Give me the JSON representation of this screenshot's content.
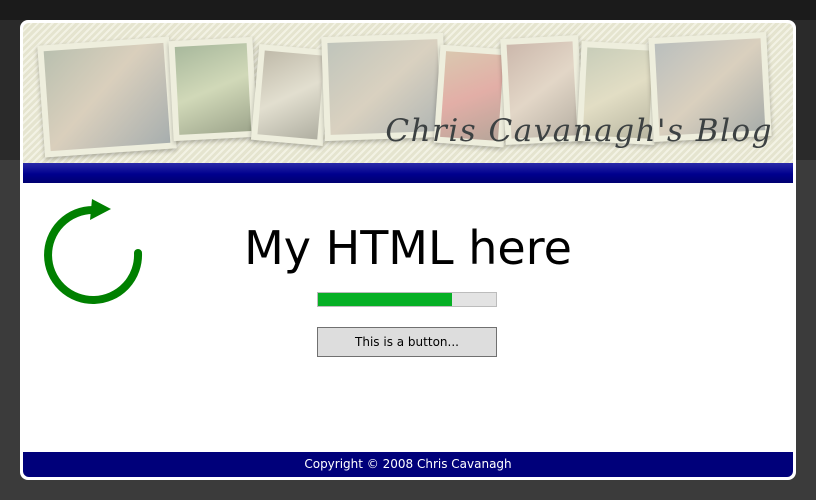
{
  "header": {
    "blog_title": "Chris Cavanagh's Blog",
    "photo_count": 8
  },
  "main": {
    "heading": "My HTML here",
    "progress_fraction": 0.75,
    "button_label": "This is a button..."
  },
  "footer": {
    "copyright": "Copyright © 2008 Chris Cavanagh"
  },
  "colors": {
    "nav_bar": "#00008e",
    "footer": "#00007a",
    "progress_fill": "#06b025",
    "refresh_icon": "#008000",
    "header_background": "#ecebd6"
  },
  "icons": {
    "refresh": "refresh-icon"
  }
}
